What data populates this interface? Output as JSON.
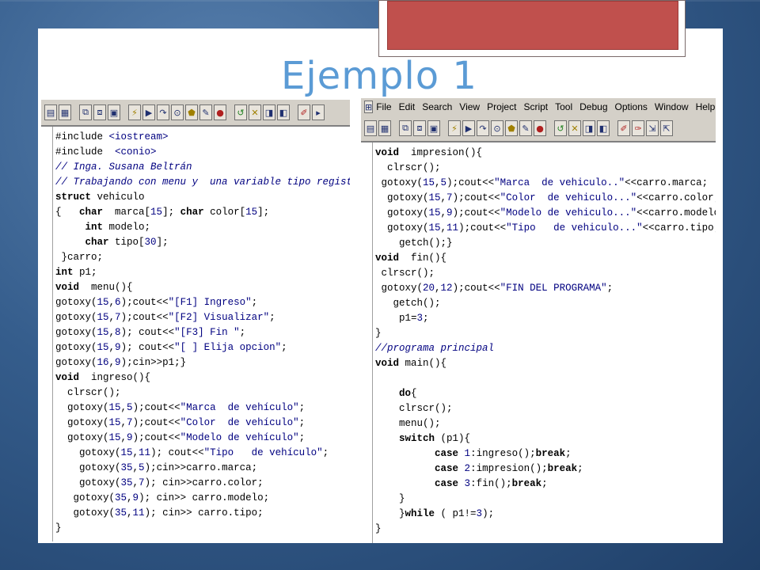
{
  "title": "Ejemplo 1",
  "colors": {
    "accent": "#c0504d",
    "title": "#5b9bd5",
    "string": "#000080"
  },
  "right_menu": [
    "File",
    "Edit",
    "Search",
    "View",
    "Project",
    "Script",
    "Tool",
    "Debug",
    "Options",
    "Window",
    "Help"
  ],
  "left_code": [
    [
      [
        "pp",
        "#include "
      ],
      [
        "str",
        "<iostream>"
      ]
    ],
    [
      [
        "pp",
        "#include  "
      ],
      [
        "str",
        "<conio>"
      ]
    ],
    [
      [
        "cmt",
        "// Inga. Susana Beltrán"
      ]
    ],
    [
      [
        "cmt",
        "// Trabajando con menu y  una variable tipo registro"
      ]
    ],
    [
      [
        "kw",
        "struct"
      ],
      [
        "pp",
        " vehiculo"
      ]
    ],
    [
      [
        "pp",
        "{   "
      ],
      [
        "kw",
        "char"
      ],
      [
        "pp",
        "  marca["
      ],
      [
        "num",
        "15"
      ],
      [
        "pp",
        "]; "
      ],
      [
        "kw",
        "char"
      ],
      [
        "pp",
        " color["
      ],
      [
        "num",
        "15"
      ],
      [
        "pp",
        "];"
      ]
    ],
    [
      [
        "pp",
        "     "
      ],
      [
        "kw",
        "int"
      ],
      [
        "pp",
        " modelo;"
      ]
    ],
    [
      [
        "pp",
        "     "
      ],
      [
        "kw",
        "char"
      ],
      [
        "pp",
        " tipo["
      ],
      [
        "num",
        "30"
      ],
      [
        "pp",
        "];"
      ]
    ],
    [
      [
        "pp",
        " }carro;"
      ]
    ],
    [
      [
        "kw",
        "int"
      ],
      [
        "pp",
        " p1;"
      ]
    ],
    [
      [
        "kw",
        "void"
      ],
      [
        "pp",
        "  menu(){"
      ]
    ],
    [
      [
        "pp",
        "gotoxy("
      ],
      [
        "num",
        "15"
      ],
      [
        "pp",
        ","
      ],
      [
        "num",
        "6"
      ],
      [
        "pp",
        ");cout<<"
      ],
      [
        "str",
        "\"[F1] Ingreso\""
      ],
      [
        "pp",
        ";"
      ]
    ],
    [
      [
        "pp",
        "gotoxy("
      ],
      [
        "num",
        "15"
      ],
      [
        "pp",
        ","
      ],
      [
        "num",
        "7"
      ],
      [
        "pp",
        ");cout<<"
      ],
      [
        "str",
        "\"[F2] Visualizar\""
      ],
      [
        "pp",
        ";"
      ]
    ],
    [
      [
        "pp",
        "gotoxy("
      ],
      [
        "num",
        "15"
      ],
      [
        "pp",
        ","
      ],
      [
        "num",
        "8"
      ],
      [
        "pp",
        "); cout<<"
      ],
      [
        "str",
        "\"[F3] Fin \""
      ],
      [
        "pp",
        ";"
      ]
    ],
    [
      [
        "pp",
        "gotoxy("
      ],
      [
        "num",
        "15"
      ],
      [
        "pp",
        ","
      ],
      [
        "num",
        "9"
      ],
      [
        "pp",
        "); cout<<"
      ],
      [
        "str",
        "\"[ ] Elija opcion\""
      ],
      [
        "pp",
        ";"
      ]
    ],
    [
      [
        "pp",
        "gotoxy("
      ],
      [
        "num",
        "16"
      ],
      [
        "pp",
        ","
      ],
      [
        "num",
        "9"
      ],
      [
        "pp",
        ");cin>>p1;}"
      ]
    ],
    [
      [
        "kw",
        "void"
      ],
      [
        "pp",
        "  ingreso(){"
      ]
    ],
    [
      [
        "pp",
        "  clrscr();"
      ]
    ],
    [
      [
        "pp",
        "  gotoxy("
      ],
      [
        "num",
        "15"
      ],
      [
        "pp",
        ","
      ],
      [
        "num",
        "5"
      ],
      [
        "pp",
        ");cout<<"
      ],
      [
        "str",
        "\"Marca  de vehículo\""
      ],
      [
        "pp",
        ";"
      ]
    ],
    [
      [
        "pp",
        "  gotoxy("
      ],
      [
        "num",
        "15"
      ],
      [
        "pp",
        ","
      ],
      [
        "num",
        "7"
      ],
      [
        "pp",
        ");cout<<"
      ],
      [
        "str",
        "\"Color  de vehículo\""
      ],
      [
        "pp",
        ";"
      ]
    ],
    [
      [
        "pp",
        "  gotoxy("
      ],
      [
        "num",
        "15"
      ],
      [
        "pp",
        ","
      ],
      [
        "num",
        "9"
      ],
      [
        "pp",
        ");cout<<"
      ],
      [
        "str",
        "\"Modelo de vehículo\""
      ],
      [
        "pp",
        ";"
      ]
    ],
    [
      [
        "pp",
        "    gotoxy("
      ],
      [
        "num",
        "15"
      ],
      [
        "pp",
        ","
      ],
      [
        "num",
        "11"
      ],
      [
        "pp",
        "); cout<<"
      ],
      [
        "str",
        "\"Tipo   de vehículo\""
      ],
      [
        "pp",
        ";"
      ]
    ],
    [
      [
        "pp",
        "    gotoxy("
      ],
      [
        "num",
        "35"
      ],
      [
        "pp",
        ","
      ],
      [
        "num",
        "5"
      ],
      [
        "pp",
        ");cin>>carro.marca;"
      ]
    ],
    [
      [
        "pp",
        "    gotoxy("
      ],
      [
        "num",
        "35"
      ],
      [
        "pp",
        ","
      ],
      [
        "num",
        "7"
      ],
      [
        "pp",
        "); cin>>carro.color;"
      ]
    ],
    [
      [
        "pp",
        "   gotoxy("
      ],
      [
        "num",
        "35"
      ],
      [
        "pp",
        ","
      ],
      [
        "num",
        "9"
      ],
      [
        "pp",
        "); cin>> carro.modelo;"
      ]
    ],
    [
      [
        "pp",
        "   gotoxy("
      ],
      [
        "num",
        "35"
      ],
      [
        "pp",
        ","
      ],
      [
        "num",
        "11"
      ],
      [
        "pp",
        "); cin>> carro.tipo;"
      ]
    ],
    [
      [
        "pp",
        "}"
      ]
    ]
  ],
  "right_code": [
    [
      [
        "kw",
        "void"
      ],
      [
        "pp",
        "  impresion(){"
      ]
    ],
    [
      [
        "pp",
        "  clrscr();"
      ]
    ],
    [
      [
        "pp",
        " gotoxy("
      ],
      [
        "num",
        "15"
      ],
      [
        "pp",
        ","
      ],
      [
        "num",
        "5"
      ],
      [
        "pp",
        ");cout<<"
      ],
      [
        "str",
        "\"Marca  de vehiculo..\""
      ],
      [
        "pp",
        "<<carro.marca;"
      ]
    ],
    [
      [
        "pp",
        "  gotoxy("
      ],
      [
        "num",
        "15"
      ],
      [
        "pp",
        ","
      ],
      [
        "num",
        "7"
      ],
      [
        "pp",
        ");cout<<"
      ],
      [
        "str",
        "\"Color  de vehiculo...\""
      ],
      [
        "pp",
        "<<carro.color;"
      ]
    ],
    [
      [
        "pp",
        "  gotoxy("
      ],
      [
        "num",
        "15"
      ],
      [
        "pp",
        ","
      ],
      [
        "num",
        "9"
      ],
      [
        "pp",
        ");cout<<"
      ],
      [
        "str",
        "\"Modelo de vehiculo...\""
      ],
      [
        "pp",
        "<<carro.modelo;"
      ]
    ],
    [
      [
        "pp",
        "  gotoxy("
      ],
      [
        "num",
        "15"
      ],
      [
        "pp",
        ","
      ],
      [
        "num",
        "11"
      ],
      [
        "pp",
        ");cout<<"
      ],
      [
        "str",
        "\"Tipo   de vehiculo...\""
      ],
      [
        "pp",
        "<<carro.tipo;"
      ]
    ],
    [
      [
        "pp",
        "    getch();}"
      ]
    ],
    [
      [
        "kw",
        "void"
      ],
      [
        "pp",
        "  fin(){"
      ]
    ],
    [
      [
        "pp",
        " clrscr();"
      ]
    ],
    [
      [
        "pp",
        " gotoxy("
      ],
      [
        "num",
        "20"
      ],
      [
        "pp",
        ","
      ],
      [
        "num",
        "12"
      ],
      [
        "pp",
        ");cout<<"
      ],
      [
        "str",
        "\"FIN DEL PROGRAMA\""
      ],
      [
        "pp",
        ";"
      ]
    ],
    [
      [
        "pp",
        "   getch();"
      ]
    ],
    [
      [
        "pp",
        "    p1="
      ],
      [
        "num",
        "3"
      ],
      [
        "pp",
        ";"
      ]
    ],
    [
      [
        "pp",
        "}"
      ]
    ],
    [
      [
        "cmt",
        "//programa principal"
      ]
    ],
    [
      [
        "kw",
        "void"
      ],
      [
        "pp",
        " main(){"
      ]
    ],
    [
      [
        "pp",
        " "
      ]
    ],
    [
      [
        "pp",
        "    "
      ],
      [
        "kw",
        "do"
      ],
      [
        "pp",
        "{"
      ]
    ],
    [
      [
        "pp",
        "    clrscr();"
      ]
    ],
    [
      [
        "pp",
        "    menu();"
      ]
    ],
    [
      [
        "pp",
        "    "
      ],
      [
        "kw",
        "switch"
      ],
      [
        "pp",
        " (p1){"
      ]
    ],
    [
      [
        "pp",
        "          "
      ],
      [
        "kw",
        "case"
      ],
      [
        "pp",
        " "
      ],
      [
        "num",
        "1"
      ],
      [
        "pp",
        ":ingreso();"
      ],
      [
        "kw",
        "break"
      ],
      [
        "pp",
        ";"
      ]
    ],
    [
      [
        "pp",
        "          "
      ],
      [
        "kw",
        "case"
      ],
      [
        "pp",
        " "
      ],
      [
        "num",
        "2"
      ],
      [
        "pp",
        ":impresion();"
      ],
      [
        "kw",
        "break"
      ],
      [
        "pp",
        ";"
      ]
    ],
    [
      [
        "pp",
        "          "
      ],
      [
        "kw",
        "case"
      ],
      [
        "pp",
        " "
      ],
      [
        "num",
        "3"
      ],
      [
        "pp",
        ":fin();"
      ],
      [
        "kw",
        "break"
      ],
      [
        "pp",
        ";"
      ]
    ],
    [
      [
        "pp",
        "    }"
      ]
    ],
    [
      [
        "pp",
        "    }"
      ],
      [
        "kw",
        "while"
      ],
      [
        "pp",
        " ( p1!="
      ],
      [
        "num",
        "3"
      ],
      [
        "pp",
        ");"
      ]
    ],
    [
      [
        "pp",
        "}"
      ]
    ]
  ]
}
